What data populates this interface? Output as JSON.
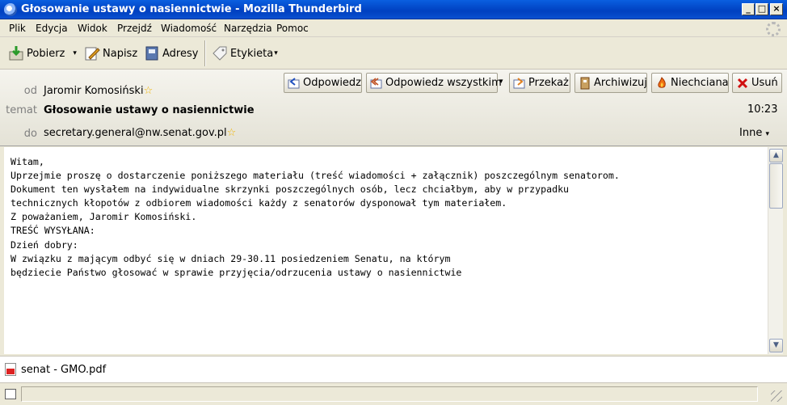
{
  "window": {
    "title": "Głosowanie ustawy o nasiennictwie - Mozilla Thunderbird",
    "controls": {
      "minimize": "_",
      "maximize": "□",
      "close": "×"
    }
  },
  "menu": [
    "Plik",
    "Edycja",
    "Widok",
    "Przejdź",
    "Wiadomość",
    "Narzędzia",
    "Pomoc"
  ],
  "toolbar": {
    "get_mail": "Pobierz",
    "write": "Napisz",
    "address_book": "Adresy",
    "tag": "Etykieta",
    "dropdown_arrow": "▾"
  },
  "header": {
    "from_label": "od",
    "from_value": "Jaromir Komosiński",
    "subject_label": "temat",
    "subject_value": "Głosowanie ustawy o nasiennictwie",
    "to_label": "do",
    "to_value": "secretary.general@nw.senat.gov.pl",
    "time": "10:23",
    "other_actions": "Inne",
    "star_glyph": "☆",
    "buttons": {
      "reply": "Odpowiedz",
      "reply_all": "Odpowiedz wszystkim",
      "forward": "Przekaż",
      "archive": "Archiwizuj",
      "junk": "Niechciana",
      "delete": "Usuń"
    }
  },
  "body": {
    "lines": [
      "Witam,",
      "",
      "Uprzejmie proszę o dostarczenie poniższego materiału (treść wiadomości + załącznik) poszczególnym senatorom.",
      "Dokument ten wysłałem na indywidualne skrzynki poszczególnych osób, lecz chciałbym, aby w przypadku",
      "technicznych kłopotów z odbiorem wiadomości każdy z senatorów dysponował tym materiałem.",
      "",
      "",
      "Z poważaniem, Jaromir Komosiński.",
      "",
      "",
      "TREŚĆ WYSYŁANA:",
      "",
      "Dzień dobry:",
      "",
      "W związku z mającym odbyć się w dniach 29-30.11 posiedzeniem Senatu, na którym",
      "będziecie Państwo głosować w sprawie przyjęcia/odrzucenia ustawy o nasiennictwie"
    ]
  },
  "scrollbar": {
    "up": "▲",
    "down": "▼"
  },
  "attachments": [
    {
      "name": "senat - GMO.pdf"
    }
  ],
  "colors": {
    "titlebar": "#0a5fe0",
    "delete_icon": "#d01010",
    "star": "#f0b400"
  }
}
